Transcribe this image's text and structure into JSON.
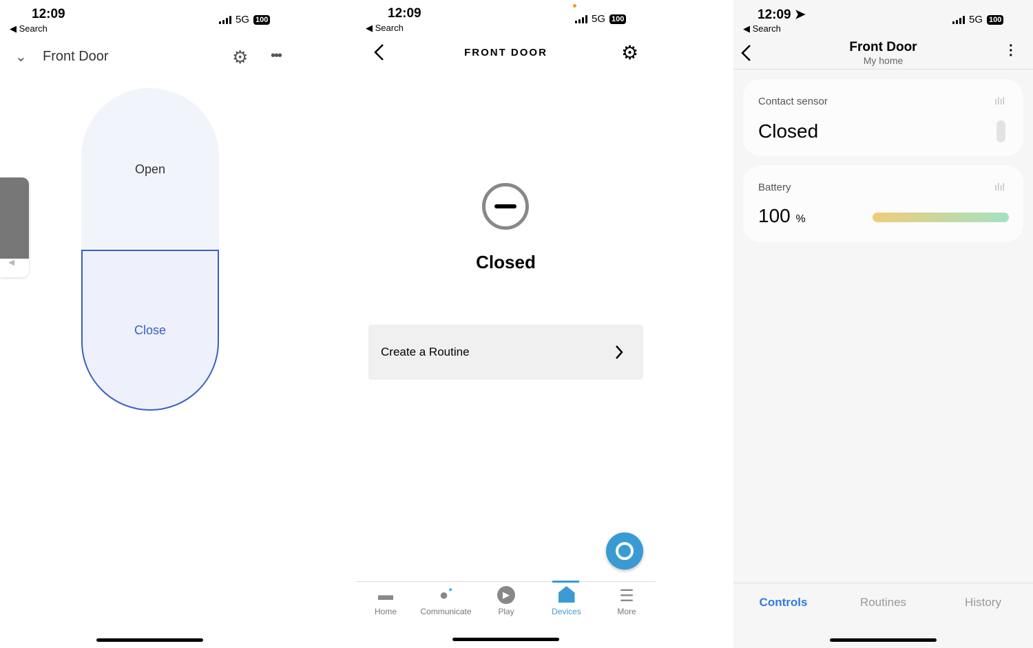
{
  "status": {
    "time": "12:09",
    "back": "◀ Search",
    "network": "5G",
    "battery": "100"
  },
  "p1": {
    "title": "Front Door",
    "open_label": "Open",
    "close_label": "Close",
    "accent": "#3a5fc0"
  },
  "p2": {
    "title": "FRONT DOOR",
    "state": "Closed",
    "routine_label": "Create a Routine",
    "nav": [
      {
        "label": "Home",
        "icon": "home-icon"
      },
      {
        "label": "Communicate",
        "icon": "chat-icon"
      },
      {
        "label": "Play",
        "icon": "play-icon"
      },
      {
        "label": "Devices",
        "icon": "devices-icon",
        "active": true
      },
      {
        "label": "More",
        "icon": "menu-icon"
      }
    ],
    "accent": "#3a9ad4"
  },
  "p3": {
    "title": "Front Door",
    "subtitle": "My home",
    "contact": {
      "label": "Contact sensor",
      "value": "Closed"
    },
    "battery": {
      "label": "Battery",
      "value": "100",
      "unit": "%",
      "level_percent": 100
    },
    "tabs": [
      {
        "label": "Controls",
        "active": true
      },
      {
        "label": "Routines"
      },
      {
        "label": "History"
      }
    ],
    "accent": "#2f7be0"
  }
}
